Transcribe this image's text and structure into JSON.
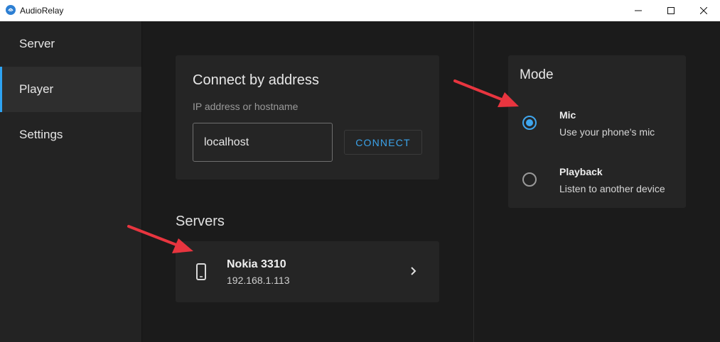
{
  "window": {
    "title": "AudioRelay"
  },
  "sidebar": {
    "items": [
      {
        "label": "Server",
        "active": false
      },
      {
        "label": "Player",
        "active": true
      },
      {
        "label": "Settings",
        "active": false
      }
    ]
  },
  "connect": {
    "title": "Connect by address",
    "field_label": "IP address or hostname",
    "field_value": "localhost",
    "button_label": "CONNECT"
  },
  "servers": {
    "title": "Servers",
    "items": [
      {
        "name": "Nokia 3310",
        "ip": "192.168.1.113",
        "icon": "smartphone-icon"
      }
    ]
  },
  "mode": {
    "title": "Mode",
    "options": [
      {
        "title": "Mic",
        "description": "Use your phone's mic",
        "selected": true
      },
      {
        "title": "Playback",
        "description": "Listen to another device",
        "selected": false
      }
    ]
  },
  "colors": {
    "accent": "#3fa6ee",
    "annotation_arrow": "#e8353f",
    "background": "#1b1b1b",
    "card": "#252525",
    "sidebar": "#232323"
  }
}
